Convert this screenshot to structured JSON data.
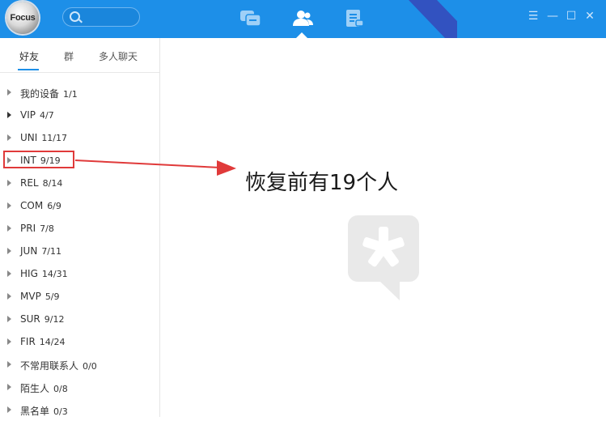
{
  "app": {
    "logo_text": "Focus",
    "search": {
      "placeholder": ""
    }
  },
  "nav": [
    {
      "id": "messages",
      "icon": "chat-bubbles-icon",
      "active": false
    },
    {
      "id": "contacts",
      "icon": "contacts-icon",
      "active": true
    },
    {
      "id": "notes",
      "icon": "notes-icon",
      "active": false
    }
  ],
  "window_controls": [
    {
      "icon": "menu-icon",
      "glyph": "☰"
    },
    {
      "icon": "minimize-icon",
      "glyph": "—"
    },
    {
      "icon": "maximize-icon",
      "glyph": "☐"
    },
    {
      "icon": "close-icon",
      "glyph": "✕"
    }
  ],
  "sidebar": {
    "tabs": [
      {
        "label": "好友",
        "active": true
      },
      {
        "label": "群",
        "active": false
      },
      {
        "label": "多人聊天",
        "active": false
      }
    ],
    "groups": [
      {
        "name": "我的设备",
        "count": "1/1"
      },
      {
        "name": "VIP",
        "count": "4/7"
      },
      {
        "name": "UNI",
        "count": "11/17"
      },
      {
        "name": "INT",
        "count": "9/19"
      },
      {
        "name": "REL",
        "count": "8/14"
      },
      {
        "name": "COM",
        "count": "6/9"
      },
      {
        "name": "PRI",
        "count": "7/8"
      },
      {
        "name": "JUN",
        "count": "7/11"
      },
      {
        "name": "HIG",
        "count": "14/31"
      },
      {
        "name": "MVP",
        "count": "5/9"
      },
      {
        "name": "SUR",
        "count": "9/12"
      },
      {
        "name": "FIR",
        "count": "14/24"
      },
      {
        "name": "不常用联系人",
        "count": "0/0"
      },
      {
        "name": "陌生人",
        "count": "0/8"
      },
      {
        "name": "黑名单",
        "count": "0/3"
      }
    ]
  },
  "annotation": {
    "text": "恢复前有19个人",
    "color": "#e03a3a"
  },
  "colors": {
    "brand": "#1d8fe8",
    "highlight": "#e03a3a"
  }
}
